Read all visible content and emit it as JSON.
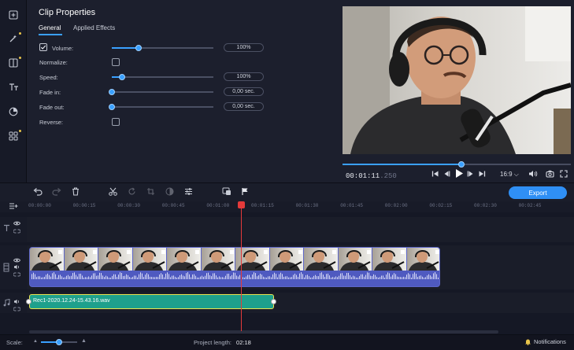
{
  "properties": {
    "title": "Clip Properties",
    "tabs": [
      {
        "label": "General",
        "active": true
      },
      {
        "label": "Applied Effects",
        "active": false
      }
    ],
    "rows": {
      "volume": {
        "label": "Volume:",
        "checked": true,
        "value_text": "100%",
        "slider": 0.26
      },
      "normalize": {
        "label": "Normalize:",
        "checked": false
      },
      "speed": {
        "label": "Speed:",
        "value_text": "100%",
        "slider": 0.1
      },
      "fade_in": {
        "label": "Fade in:",
        "value_text": "0,00 sec.",
        "slider": 0.0
      },
      "fade_out": {
        "label": "Fade out:",
        "value_text": "0,00 sec.",
        "slider": 0.0
      },
      "reverse": {
        "label": "Reverse:",
        "checked": false
      }
    }
  },
  "preview": {
    "timecode_main": "00:01:11",
    "timecode_ms": ".250",
    "seek_progress": 0.52,
    "aspect_ratio": "16:9 ⌵"
  },
  "toolbar": {
    "export_label": "Export"
  },
  "ruler": {
    "ticks": [
      "00:00:00",
      "00:00:15",
      "00:00:30",
      "00:00:45",
      "00:01:00",
      "00:01:15",
      "00:01:30",
      "00:01:45",
      "00:02:00",
      "00:02:15",
      "00:02:30",
      "00:02:45"
    ]
  },
  "timeline": {
    "audio_clip_name": "Rec1-2020.12.24-15.43.16.wav",
    "thumb_count": 12
  },
  "status": {
    "scale_label": "Scale:",
    "scale_value": 0.5,
    "project_length_label": "Project length:",
    "project_length": "02:18",
    "notifications_label": "Notifications"
  },
  "colors": {
    "accent": "#2f8ff5",
    "playhead": "#e43a3a",
    "audio_clip": "#1ea08c",
    "video_clip": "#4f5ac0"
  }
}
